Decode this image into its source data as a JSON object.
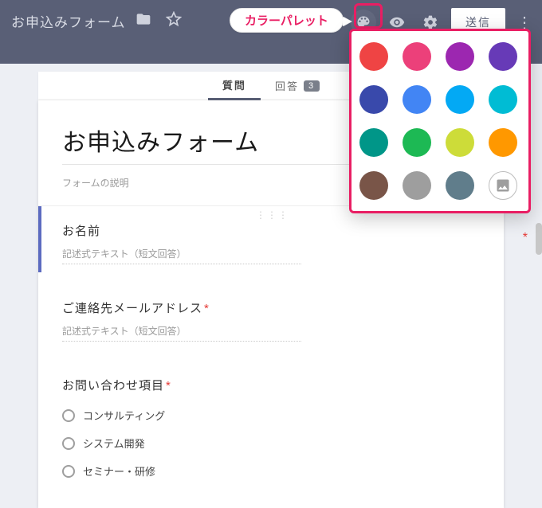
{
  "header": {
    "doc_title": "お申込みフォーム",
    "send_label": "送信"
  },
  "callout": {
    "label": "カラーパレット"
  },
  "tabs": {
    "questions": "質問",
    "responses": "回答",
    "response_badge": "3"
  },
  "form": {
    "title": "お申込みフォーム",
    "description": "フォームの説明",
    "q1_title": "お名前",
    "q1_helper": "記述式テキスト（短文回答）",
    "q2_title": "ご連絡先メールアドレス",
    "q2_helper": "記述式テキスト（短文回答）",
    "q3_title": "お問い合わせ項目",
    "q3_options": [
      "コンサルティング",
      "システム開発",
      "セミナー・研修"
    ]
  },
  "palette": {
    "colors": [
      "#ef4444",
      "#ec407a",
      "#9c27b0",
      "#673ab7",
      "#3949ab",
      "#4285f4",
      "#03a9f4",
      "#00bcd4",
      "#009688",
      "#1db954",
      "#cddc39",
      "#ff9800",
      "#795548",
      "#9e9e9e",
      "#607d8b"
    ],
    "image_option": true
  }
}
